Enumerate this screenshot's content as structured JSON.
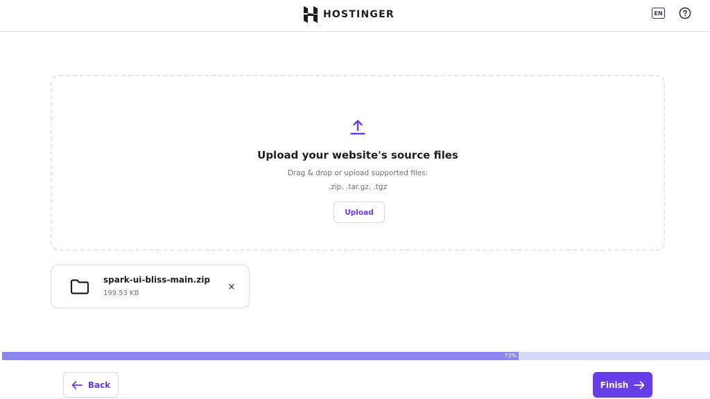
{
  "header": {
    "brand": "HOSTINGER",
    "language": "EN"
  },
  "dropzone": {
    "title": "Upload your website's source files",
    "subtitle": "Drag & drop or upload supported files:",
    "formats": ".zip, .tar.gz, .tgz",
    "upload_label": "Upload"
  },
  "file": {
    "name": "spark-ui-bliss-main.zip",
    "size": "199.53 KB",
    "remove_symbol": "×"
  },
  "progress": {
    "percent": 73,
    "label": "73%"
  },
  "footer": {
    "back_label": "Back",
    "finish_label": "Finish"
  },
  "colors": {
    "accent": "#673de6",
    "progress_fill": "#8c85f0",
    "progress_track": "#d5d8fa"
  },
  "icons": {
    "logo": "hostinger-logo-icon",
    "language": "language-icon",
    "help": "question-circle-icon",
    "upload": "upload-arrow-icon",
    "file": "folder-icon",
    "remove": "close-icon",
    "back": "arrow-left-icon",
    "finish": "arrow-right-icon"
  }
}
